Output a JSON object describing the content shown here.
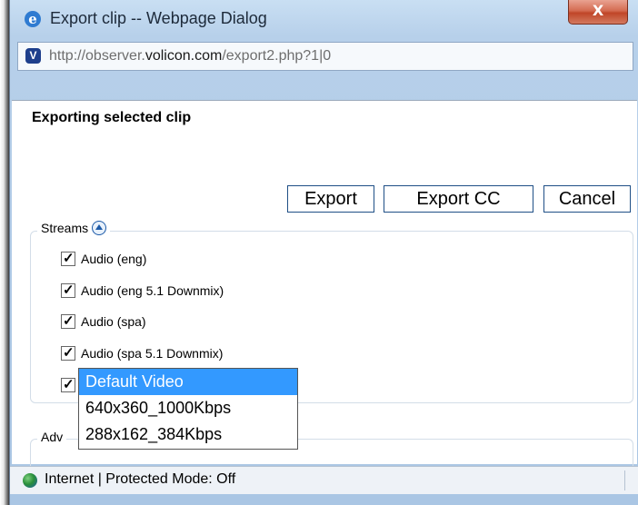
{
  "window": {
    "title": "Export clip -- Webpage Dialog",
    "close_label": "X",
    "url_prefix": "http://observer.",
    "url_domain": "volicon.com",
    "url_path": "/export2.php?1|0"
  },
  "dialog": {
    "heading": "Exporting selected clip",
    "export_label": "Export",
    "export_cc_label": "Export CC",
    "cancel_label": "Cancel"
  },
  "streams": {
    "legend": "Streams",
    "items": [
      {
        "label": "Audio (eng)",
        "checked": true
      },
      {
        "label": "Audio (eng 5.1 Downmix)",
        "checked": true
      },
      {
        "label": "Audio (spa)",
        "checked": true
      },
      {
        "label": "Audio (spa 5.1 Downmix)",
        "checked": true
      }
    ],
    "video_checked": true
  },
  "video_dropdown": {
    "options": [
      "Default Video",
      "640x360_1000Kbps",
      "288x162_384Kbps"
    ],
    "selected": "Default Video"
  },
  "advanced": {
    "legend_visible": "Adv"
  },
  "status": {
    "text": "Internet | Protected Mode: Off"
  },
  "colors": {
    "selection": "#3399ff",
    "button_border": "#1f4f86",
    "close_button": "#c04628"
  }
}
